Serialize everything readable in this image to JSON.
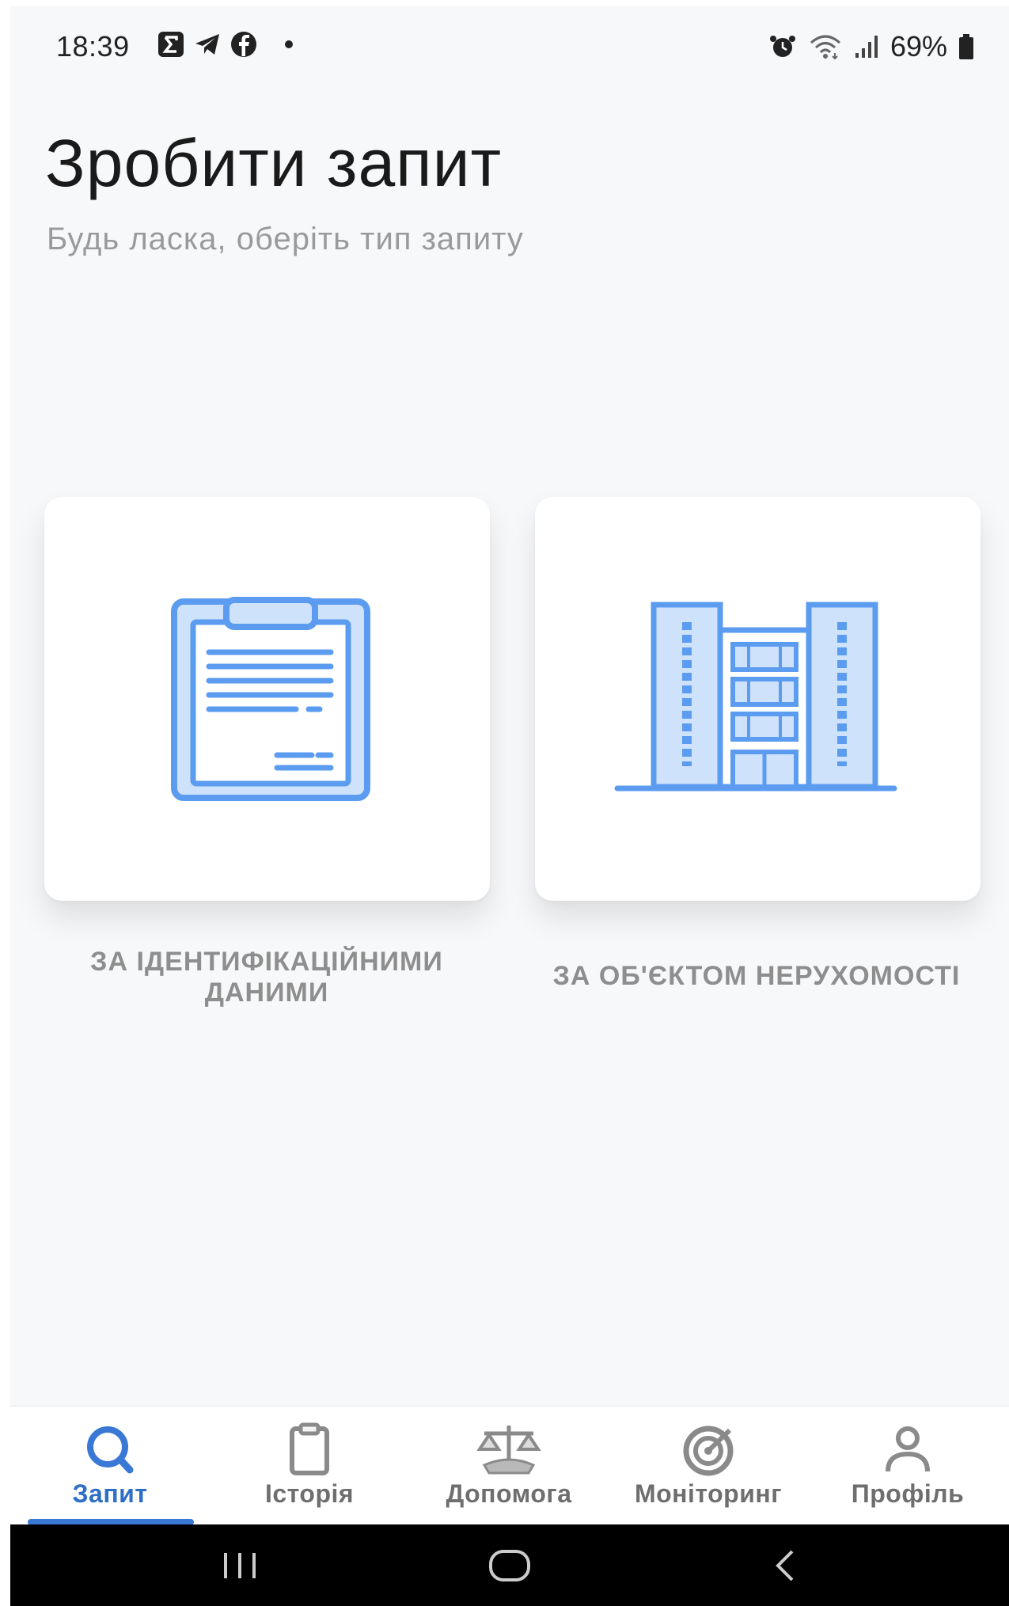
{
  "status_bar": {
    "time": "18:39",
    "battery": "69%",
    "left_icons": [
      "sigma-app-icon",
      "telegram-icon",
      "facebook-icon",
      "notification-dot"
    ],
    "right_icons": [
      "alarm-icon",
      "wifi-icon",
      "signal-icon",
      "battery-icon"
    ]
  },
  "page": {
    "title": "Зробити запит",
    "subtitle": "Будь ласка, оберіть тип запиту"
  },
  "options": [
    {
      "label": "ЗА ІДЕНТИФІКАЦІЙНИМИ ДАНИМИ",
      "icon": "document-clipboard-icon"
    },
    {
      "label": "ЗА ОБ'ЄКТОМ НЕРУХОМОСТІ",
      "icon": "building-icon"
    }
  ],
  "nav": {
    "items": [
      {
        "label": "Запит",
        "icon": "search-icon",
        "active": true
      },
      {
        "label": "Історія",
        "icon": "clipboard-icon",
        "active": false
      },
      {
        "label": "Допомога",
        "icon": "scales-icon",
        "active": false
      },
      {
        "label": "Моніторинг",
        "icon": "radar-icon",
        "active": false
      },
      {
        "label": "Профіль",
        "icon": "user-icon",
        "active": false
      }
    ]
  },
  "system_nav": [
    "recents-button",
    "home-button",
    "back-button"
  ],
  "colors": {
    "accent": "#3a78d6",
    "icon_fill": "#cfe2fb",
    "icon_stroke": "#5b9cf0",
    "background": "#f7f8fa",
    "label_gray": "#8e8e8e"
  }
}
